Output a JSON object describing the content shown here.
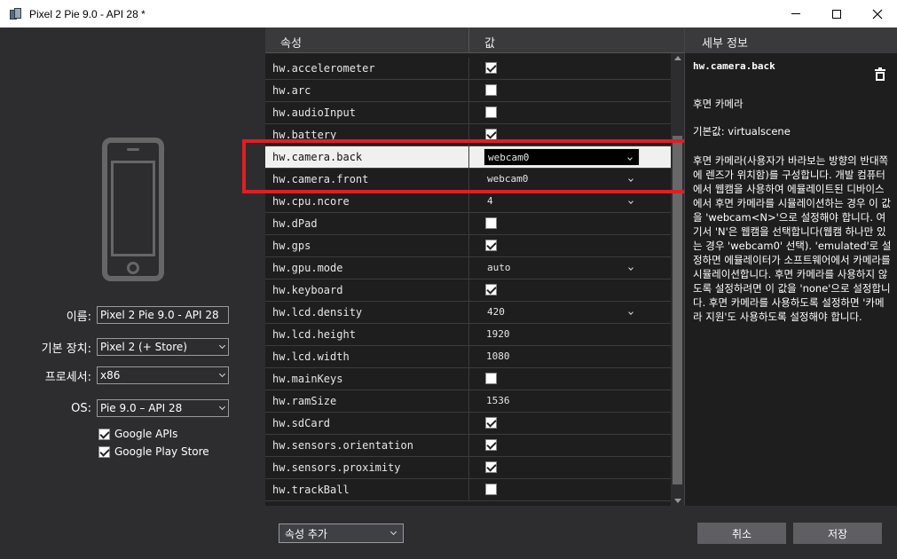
{
  "window": {
    "title": "Pixel 2 Pie 9.0 - API 28 *"
  },
  "left": {
    "name_label": "이름:",
    "name_value": "Pixel 2 Pie 9.0 - API 28",
    "device_label": "기본 장치:",
    "device_value": "Pixel 2 (+ Store)",
    "processor_label": "프로세서:",
    "processor_value": "x86",
    "os_label": "OS:",
    "os_value": "Pie 9.0 – API 28",
    "google_apis": {
      "label": "Google APIs",
      "checked": true
    },
    "google_play": {
      "label": "Google Play Store",
      "checked": true
    }
  },
  "grid": {
    "col_property": "속성",
    "col_value": "값",
    "rows": [
      {
        "name": "hw.accelerometer",
        "type": "checkbox",
        "checked": true
      },
      {
        "name": "hw.arc",
        "type": "checkbox",
        "checked": false
      },
      {
        "name": "hw.audioInput",
        "type": "checkbox",
        "checked": false
      },
      {
        "name": "hw.battery",
        "type": "checkbox",
        "checked": true
      },
      {
        "name": "hw.camera.back",
        "type": "dropdown",
        "value": "webcam0",
        "selected": true
      },
      {
        "name": "hw.camera.front",
        "type": "dropdown",
        "value": "webcam0"
      },
      {
        "name": "hw.cpu.ncore",
        "type": "dropdown",
        "value": "4"
      },
      {
        "name": "hw.dPad",
        "type": "checkbox",
        "checked": false
      },
      {
        "name": "hw.gps",
        "type": "checkbox",
        "checked": true
      },
      {
        "name": "hw.gpu.mode",
        "type": "dropdown",
        "value": "auto"
      },
      {
        "name": "hw.keyboard",
        "type": "checkbox",
        "checked": true
      },
      {
        "name": "hw.lcd.density",
        "type": "dropdown",
        "value": "420"
      },
      {
        "name": "hw.lcd.height",
        "type": "text",
        "value": "1920"
      },
      {
        "name": "hw.lcd.width",
        "type": "text",
        "value": "1080"
      },
      {
        "name": "hw.mainKeys",
        "type": "checkbox",
        "checked": false
      },
      {
        "name": "hw.ramSize",
        "type": "text",
        "value": "1536"
      },
      {
        "name": "hw.sdCard",
        "type": "checkbox",
        "checked": true
      },
      {
        "name": "hw.sensors.orientation",
        "type": "checkbox",
        "checked": true
      },
      {
        "name": "hw.sensors.proximity",
        "type": "checkbox",
        "checked": true
      },
      {
        "name": "hw.trackBall",
        "type": "checkbox",
        "checked": false
      }
    ]
  },
  "details": {
    "header": "세부 정보",
    "property": "hw.camera.back",
    "friendly_name": "후면 카메라",
    "default": "기본값: virtualscene",
    "description": "후면 카메라(사용자가 바라보는 방향의 반대쪽에 렌즈가 위치함)를 구성합니다. 개발 컴퓨터에서 웹캠을 사용하여 에뮬레이트된 디바이스에서 후면 카메라를 시뮬레이션하는 경우 이 값을 'webcam<N>'으로 설정해야 합니다. 여기서 'N'은 웹캠을 선택합니다(웹캠 하나만 있는 경우 'webcam0' 선택). 'emulated'로 설정하면 에뮬레이터가 소프트웨어에서 카메라를 시뮬레이션합니다. 후면 카메라를 사용하지 않도록 설정하려면 이 값을 'none'으로 설정합니다. 후면 카메라를 사용하도록 설정하면 '카메라 지원'도 사용하도록 설정해야 합니다."
  },
  "bottom": {
    "add_property": "속성 추가",
    "cancel": "취소",
    "save": "저장"
  },
  "colors": {
    "highlight": "#e01e26"
  }
}
